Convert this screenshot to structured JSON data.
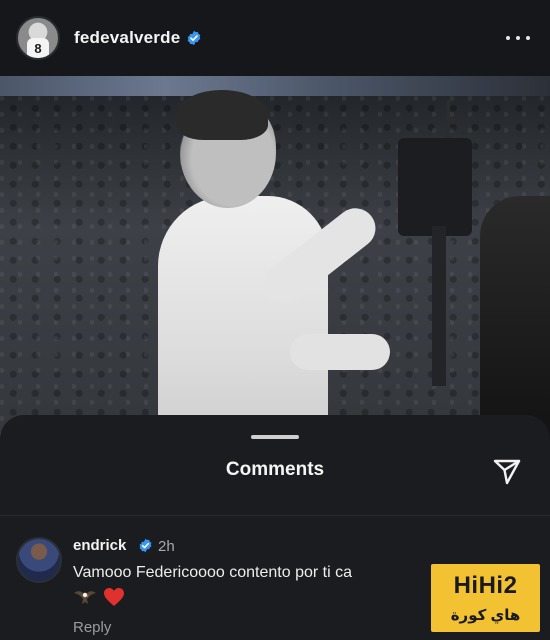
{
  "post": {
    "username": "fedevalverde",
    "avatar_jersey_number": "8",
    "icons": {
      "verified": "verified-badge-icon",
      "more": "more-options-icon"
    }
  },
  "comments_sheet": {
    "title": "Comments",
    "icons": {
      "share": "send-icon"
    },
    "comments": [
      {
        "username": "endrick",
        "verified": true,
        "time": "2h",
        "text": "Vamooo Federicoooo contento por ti ca",
        "emojis": [
          "eagle-emoji",
          "red-heart-emoji"
        ],
        "reply_label": "Reply"
      }
    ]
  },
  "watermark": {
    "main": "HiHi2",
    "sub": "هاي كورة"
  },
  "colors": {
    "background": "#121417",
    "sheet": "#1a1c20",
    "verified_blue": "#3897f0",
    "heart_red": "#e0312c",
    "watermark_yellow": "#f2c232"
  }
}
